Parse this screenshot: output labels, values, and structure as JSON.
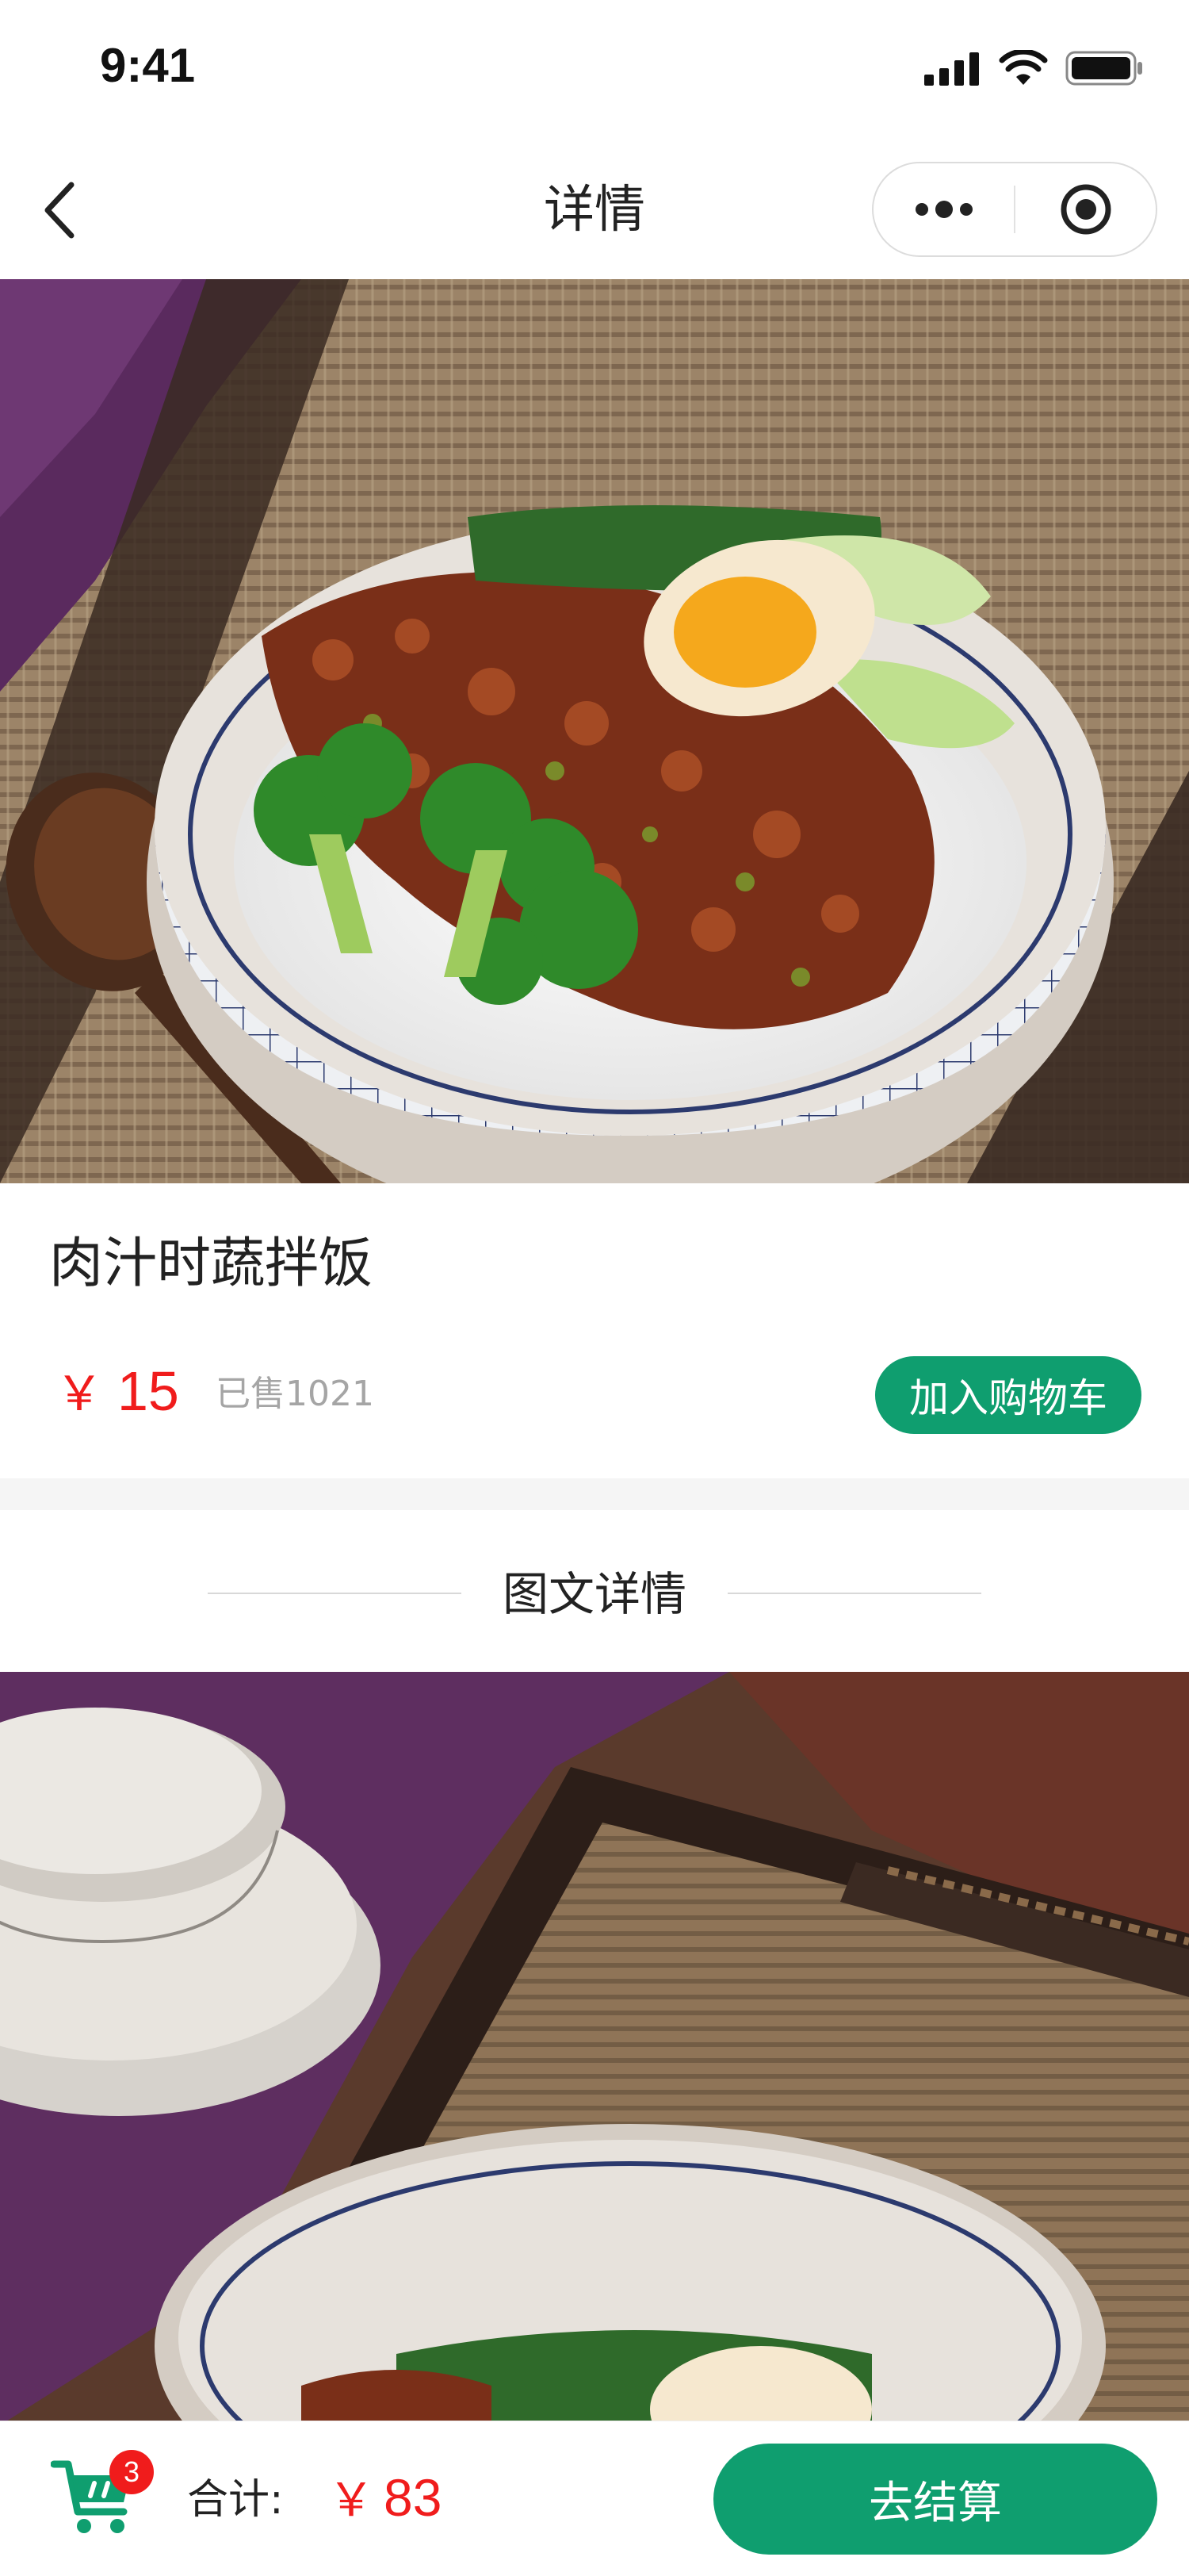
{
  "status_bar": {
    "time": "9:41",
    "icons": [
      "signal-icon",
      "wifi-icon",
      "battery-icon"
    ]
  },
  "nav": {
    "title": "详情",
    "icons": [
      "back-icon",
      "more-dots-icon",
      "target-icon"
    ]
  },
  "product": {
    "name": "肉汁时蔬拌饭",
    "currency": "￥",
    "price": "15",
    "sold_label": "已售",
    "sold_count": "1021",
    "add_to_cart_label": "加入购物车"
  },
  "details_section": {
    "title": "图文详情"
  },
  "bottom_bar": {
    "cart_count": "3",
    "total_label": "合计:",
    "currency": "￥",
    "total_amount": "83",
    "checkout_label": "去结算"
  },
  "colors": {
    "accent_green": "#0f9e6f",
    "price_red": "#f01c1c",
    "muted_gray": "#a5a5a5"
  }
}
